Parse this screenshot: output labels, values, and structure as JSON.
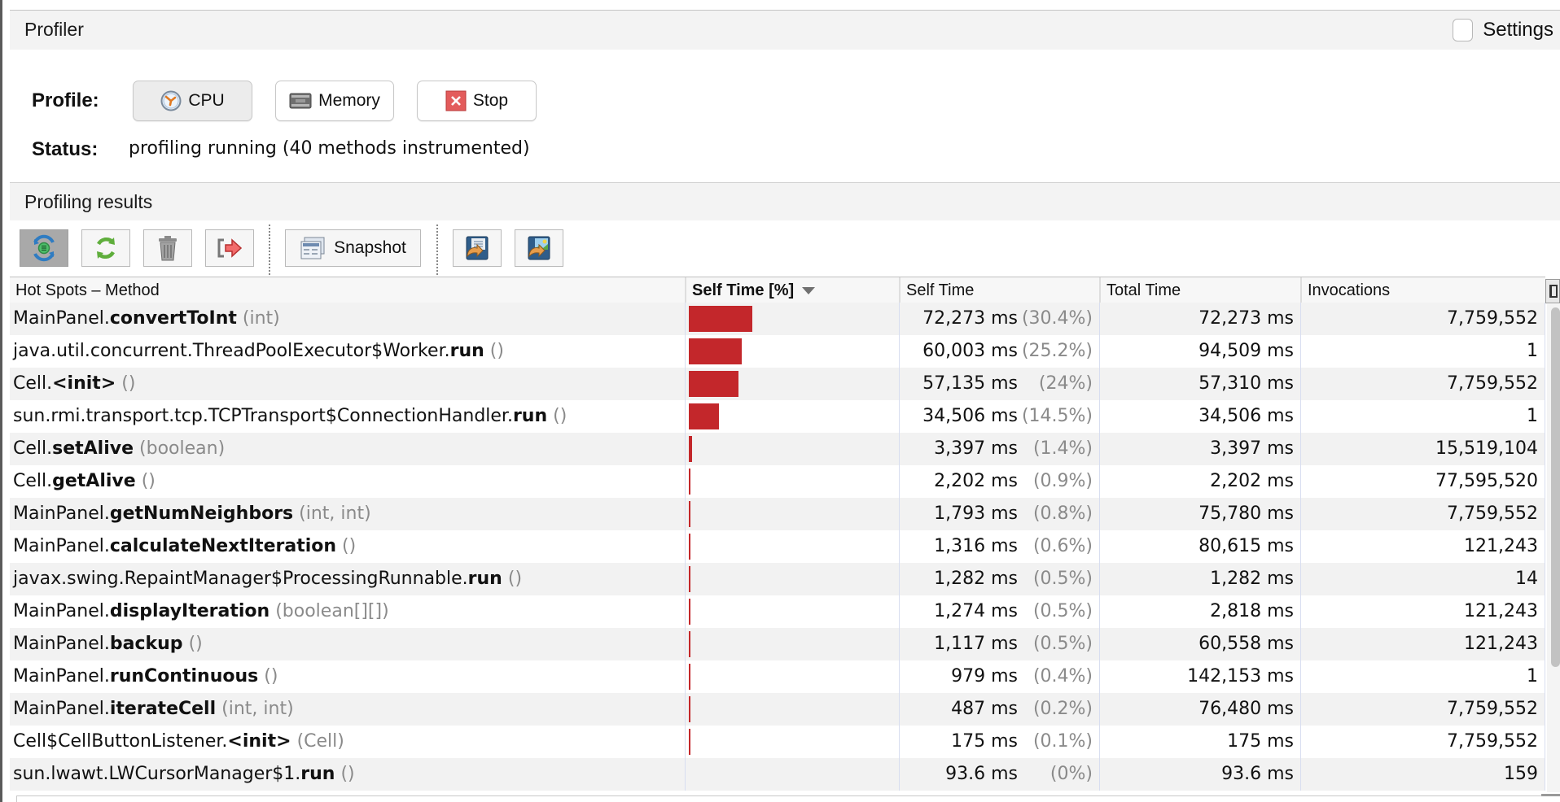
{
  "profiler": {
    "title": "Profiler",
    "settings_label": "Settings",
    "settings_checked": false,
    "profile_label": "Profile:",
    "buttons": {
      "cpu": {
        "label": "CPU",
        "icon": "clock-icon",
        "active": true
      },
      "memory": {
        "label": "Memory",
        "icon": "memory-chip-icon"
      },
      "stop": {
        "label": "Stop",
        "icon": "stop-x-icon"
      }
    },
    "status_label": "Status:",
    "status_text": "profiling running (40 methods instrumented)"
  },
  "results": {
    "title": "Profiling results",
    "toolbar": [
      {
        "name": "live-results",
        "icon": "live-results-icon",
        "selected": true
      },
      {
        "name": "refresh",
        "icon": "refresh-icon"
      },
      {
        "name": "reset",
        "icon": "trash-icon"
      },
      {
        "name": "export",
        "icon": "export-arrow-icon"
      },
      {
        "name": "snapshot",
        "icon": "snapshot-icon",
        "label": "Snapshot"
      },
      {
        "name": "save",
        "icon": "save-icon"
      },
      {
        "name": "save-image",
        "icon": "save-image-icon"
      }
    ],
    "columns": [
      {
        "label": "Hot Spots – Method"
      },
      {
        "label": "Self Time [%]",
        "sorted": "descending"
      },
      {
        "label": "Self Time"
      },
      {
        "label": "Total Time"
      },
      {
        "label": "Invocations"
      }
    ],
    "bar_color": "#c3272b",
    "rows": [
      {
        "pkg": "MainPanel.",
        "method": "convertToInt",
        "params": "(int)",
        "self_pct": 30.4,
        "self_time": "72,273 ms",
        "self_pct_label": "(30.4%)",
        "total_time": "72,273 ms",
        "invocations": "7,759,552"
      },
      {
        "pkg": "java.util.concurrent.ThreadPoolExecutor$Worker.",
        "method": "run",
        "params": "()",
        "self_pct": 25.2,
        "self_time": "60,003 ms",
        "self_pct_label": "(25.2%)",
        "total_time": "94,509 ms",
        "invocations": "1"
      },
      {
        "pkg": "Cell.",
        "method": "<init>",
        "params": "()",
        "self_pct": 24,
        "self_time": "57,135 ms",
        "self_pct_label": "(24%)",
        "total_time": "57,310 ms",
        "invocations": "7,759,552"
      },
      {
        "pkg": "sun.rmi.transport.tcp.TCPTransport$ConnectionHandler.",
        "method": "run",
        "params": "()",
        "self_pct": 14.5,
        "self_time": "34,506 ms",
        "self_pct_label": "(14.5%)",
        "total_time": "34,506 ms",
        "invocations": "1"
      },
      {
        "pkg": "Cell.",
        "method": "setAlive",
        "params": "(boolean)",
        "self_pct": 1.4,
        "self_time": "3,397 ms",
        "self_pct_label": "(1.4%)",
        "total_time": "3,397 ms",
        "invocations": "15,519,104"
      },
      {
        "pkg": "Cell.",
        "method": "getAlive",
        "params": "()",
        "self_pct": 0.9,
        "self_time": "2,202 ms",
        "self_pct_label": "(0.9%)",
        "total_time": "2,202 ms",
        "invocations": "77,595,520"
      },
      {
        "pkg": "MainPanel.",
        "method": "getNumNeighbors",
        "params": "(int, int)",
        "self_pct": 0.8,
        "self_time": "1,793 ms",
        "self_pct_label": "(0.8%)",
        "total_time": "75,780 ms",
        "invocations": "7,759,552"
      },
      {
        "pkg": "MainPanel.",
        "method": "calculateNextIteration",
        "params": "()",
        "self_pct": 0.6,
        "self_time": "1,316 ms",
        "self_pct_label": "(0.6%)",
        "total_time": "80,615 ms",
        "invocations": "121,243"
      },
      {
        "pkg": "javax.swing.RepaintManager$ProcessingRunnable.",
        "method": "run",
        "params": "()",
        "self_pct": 0.5,
        "self_time": "1,282 ms",
        "self_pct_label": "(0.5%)",
        "total_time": "1,282 ms",
        "invocations": "14"
      },
      {
        "pkg": "MainPanel.",
        "method": "displayIteration",
        "params": "(boolean[][])",
        "self_pct": 0.5,
        "self_time": "1,274 ms",
        "self_pct_label": "(0.5%)",
        "total_time": "2,818 ms",
        "invocations": "121,243"
      },
      {
        "pkg": "MainPanel.",
        "method": "backup",
        "params": "()",
        "self_pct": 0.5,
        "self_time": "1,117 ms",
        "self_pct_label": "(0.5%)",
        "total_time": "60,558 ms",
        "invocations": "121,243"
      },
      {
        "pkg": "MainPanel.",
        "method": "runContinuous",
        "params": "()",
        "self_pct": 0.4,
        "self_time": "979 ms",
        "self_pct_label": "(0.4%)",
        "total_time": "142,153 ms",
        "invocations": "1"
      },
      {
        "pkg": "MainPanel.",
        "method": "iterateCell",
        "params": "(int, int)",
        "self_pct": 0.2,
        "self_time": "487 ms",
        "self_pct_label": "(0.2%)",
        "total_time": "76,480 ms",
        "invocations": "7,759,552"
      },
      {
        "pkg": "Cell$CellButtonListener.",
        "method": "<init>",
        "params": "(Cell)",
        "self_pct": 0.1,
        "self_time": "175 ms",
        "self_pct_label": "(0.1%)",
        "total_time": "175 ms",
        "invocations": "7,759,552"
      },
      {
        "pkg": "sun.lwawt.LWCursorManager$1.",
        "method": "run",
        "params": "()",
        "self_pct": 0,
        "self_time": "93.6 ms",
        "self_pct_label": "(0%)",
        "total_time": "93.6 ms",
        "invocations": "159"
      }
    ]
  }
}
